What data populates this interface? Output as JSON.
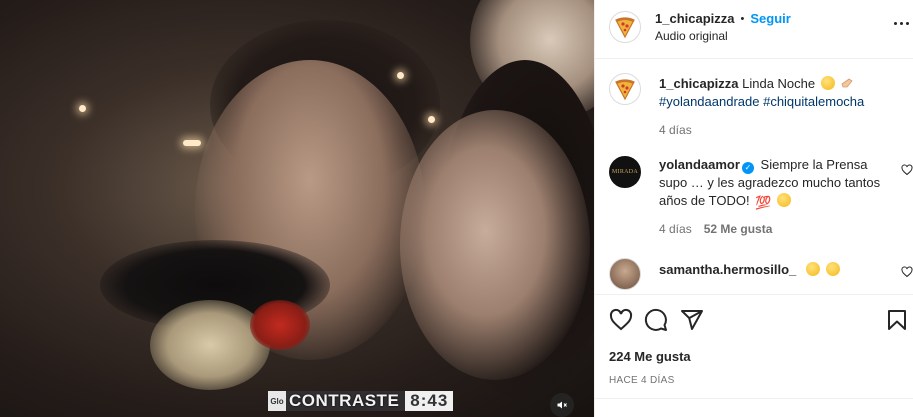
{
  "post": {
    "username": "1_chicapizza",
    "separator": "•",
    "follow_label": "Seguir",
    "audio_label": "Audio original"
  },
  "caption": {
    "username": "1_chicapizza",
    "text": "Linda Noche",
    "hashtags": "#yolandaandrade #chiquitalemocha",
    "age": "4 días"
  },
  "comments": [
    {
      "username": "yolandaamor",
      "verified": true,
      "text": "Siempre la Prensa supo … y les agradezco mucho tantos años de TODO!",
      "age": "4 días",
      "likes": "52 Me gusta",
      "avatar_label": "MIRADA"
    },
    {
      "username": "samantha.hermosillo_",
      "text": "",
      "age": "",
      "likes": ""
    }
  ],
  "engagement": {
    "likes_label": "224 Me gusta",
    "date_label": "HACE 4 DÍAS"
  },
  "video": {
    "overlay_text": "CONTRASTE",
    "overlay_time": "8:43",
    "overlay_logo": "Glo"
  },
  "icons": [
    "pizza-avatar-icon",
    "more-icon",
    "heart-icon",
    "comment-icon",
    "share-icon",
    "save-icon",
    "mute-icon",
    "verified-icon"
  ],
  "colors": {
    "accent": "#0095f6",
    "text": "#262626",
    "muted": "#737373",
    "link": "#00376b"
  }
}
